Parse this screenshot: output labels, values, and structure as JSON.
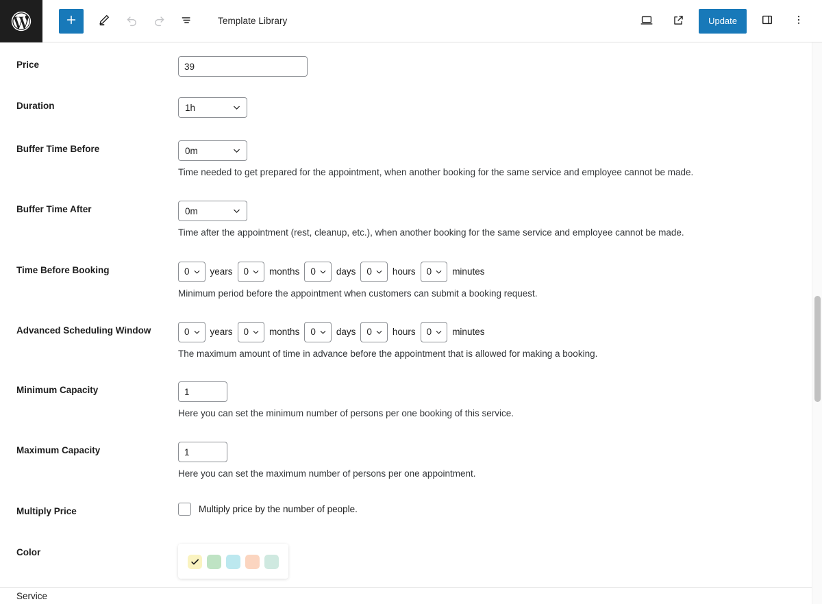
{
  "toolbar": {
    "logo_icon": "wordpress-logo-icon",
    "add_block_label": "+",
    "add_block_icon": "plus-icon",
    "tools_icon": "pencil-icon",
    "undo_icon": "undo-icon",
    "redo_icon": "redo-icon",
    "list_view_icon": "document-outline-icon",
    "document_title": "Template Library",
    "view_icon": "desktop-preview-icon",
    "external_icon": "view-external-link-icon",
    "update_label": "Update",
    "settings_icon": "settings-sidebar-icon",
    "options_icon": "more-options-icon",
    "accent_color": "#1879b9"
  },
  "form": {
    "price": {
      "label": "Price",
      "value": "39"
    },
    "duration": {
      "label": "Duration",
      "value": "1h"
    },
    "buffer_before": {
      "label": "Buffer Time Before",
      "value": "0m",
      "description": "Time needed to get prepared for the appointment, when another booking for the same service and employee cannot be made."
    },
    "buffer_after": {
      "label": "Buffer Time After",
      "value": "0m",
      "description": "Time after the appointment (rest, cleanup, etc.), when another booking for the same service and employee cannot be made."
    },
    "time_before_booking": {
      "label": "Time Before Booking",
      "years": "0",
      "years_unit": "years",
      "months": "0",
      "months_unit": "months",
      "days": "0",
      "days_unit": "days",
      "hours": "0",
      "hours_unit": "hours",
      "minutes": "0",
      "minutes_unit": "minutes",
      "description": "Minimum period before the appointment when customers can submit a booking request."
    },
    "advanced_scheduling_window": {
      "label": "Advanced Scheduling Window",
      "years": "0",
      "years_unit": "years",
      "months": "0",
      "months_unit": "months",
      "days": "0",
      "days_unit": "days",
      "hours": "0",
      "hours_unit": "hours",
      "minutes": "0",
      "minutes_unit": "minutes",
      "description": "The maximum amount of time in advance before the appointment that is allowed for making a booking."
    },
    "minimum_capacity": {
      "label": "Minimum Capacity",
      "value": "1",
      "description": "Here you can set the minimum number of persons per one booking of this service."
    },
    "maximum_capacity": {
      "label": "Maximum Capacity",
      "value": "1",
      "description": "Here you can set the maximum number of persons per one appointment."
    },
    "multiply_price": {
      "label": "Multiply Price",
      "checkbox_label": "Multiply price by the number of people.",
      "checked": false
    },
    "color": {
      "label": "Color",
      "swatches": [
        {
          "name": "yellow",
          "hex": "#faf3c0",
          "selected": true
        },
        {
          "name": "green",
          "hex": "#bfe3c4",
          "selected": false
        },
        {
          "name": "cyan",
          "hex": "#bce8ef",
          "selected": false
        },
        {
          "name": "peach",
          "hex": "#fbd5c0",
          "selected": false
        },
        {
          "name": "mint",
          "hex": "#cfe9e0",
          "selected": false
        }
      ]
    }
  },
  "bottom_bar": {
    "breadcrumb": "Service"
  }
}
